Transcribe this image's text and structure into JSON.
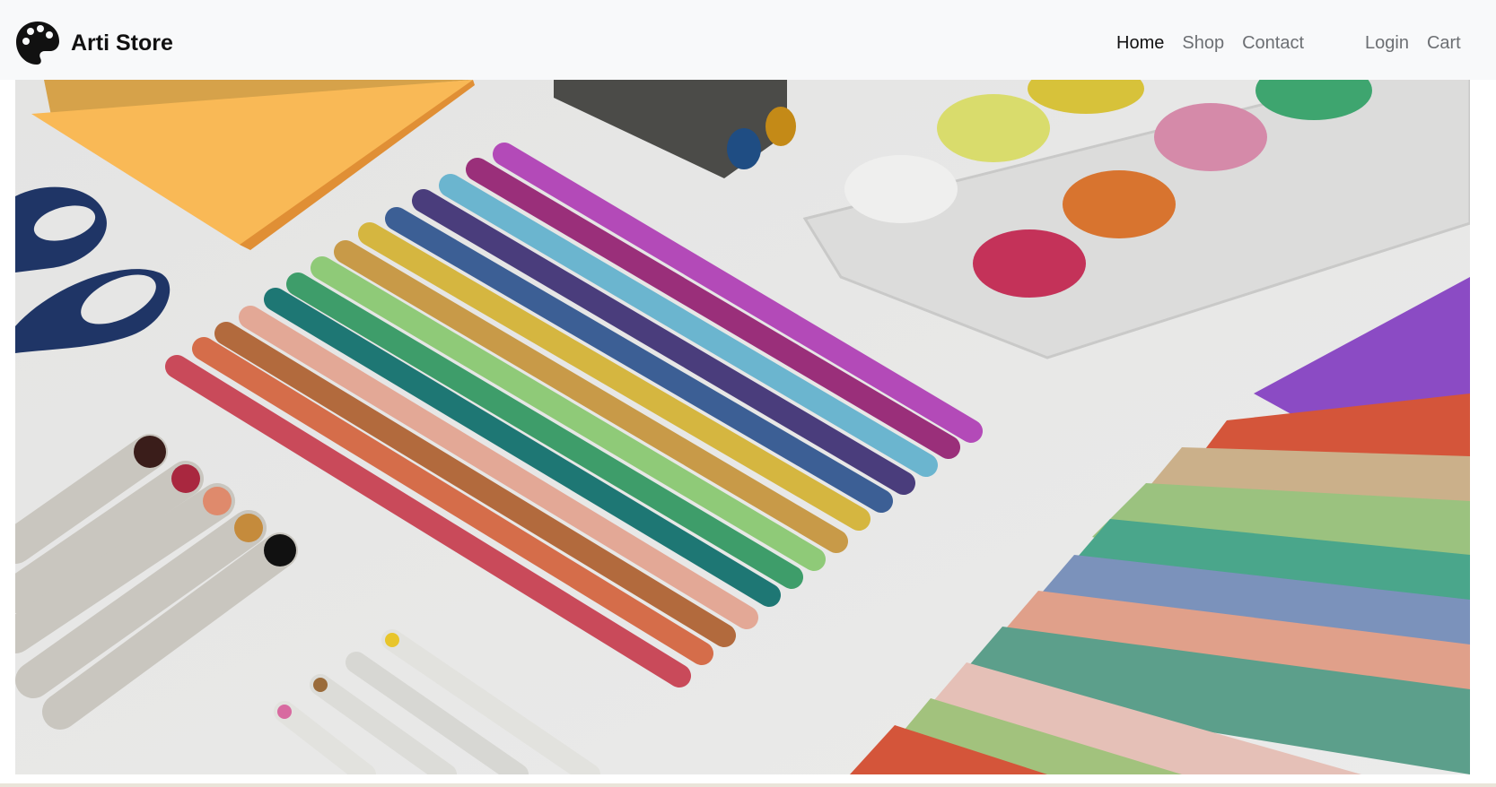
{
  "brand": {
    "name": "Arti Store",
    "logo_icon": "palette-icon"
  },
  "nav": {
    "main": [
      {
        "label": "Home",
        "active": true
      },
      {
        "label": "Shop",
        "active": false
      },
      {
        "label": "Contact",
        "active": false
      }
    ],
    "right": [
      {
        "label": "Login"
      },
      {
        "label": "Cart"
      }
    ]
  },
  "hero": {
    "image": "art-supplies-photo",
    "colors": {
      "background": "#e7e7e6",
      "navbar": "#f8f9fa",
      "sticky_note": "#f9b956",
      "scissors": "#1f3566"
    }
  }
}
